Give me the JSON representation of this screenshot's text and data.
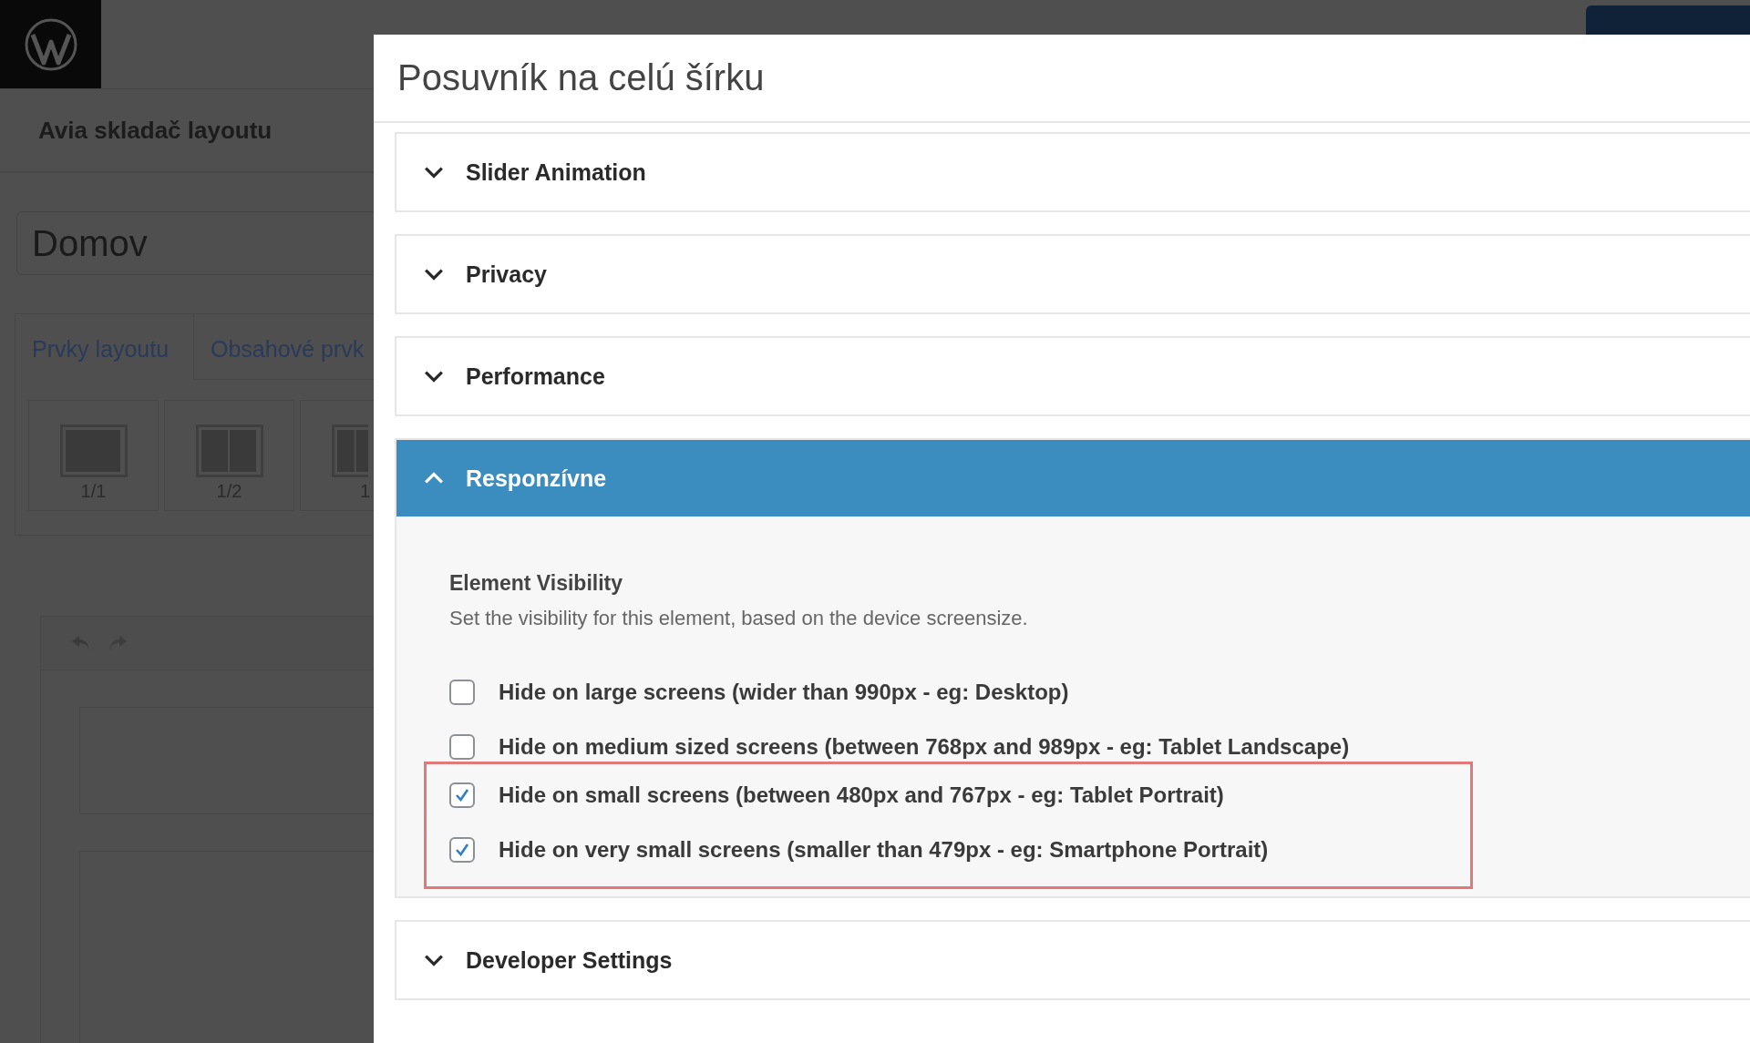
{
  "background": {
    "builder_title": "Avia skladač layoutu",
    "post_title": "Domov",
    "tabs": [
      {
        "label": "Prvky layoutu",
        "selected": true
      },
      {
        "label": "Obsahové prvk",
        "selected": false
      }
    ],
    "layout_tiles": [
      {
        "label": "1/1"
      },
      {
        "label": "1/2"
      },
      {
        "label": "1"
      }
    ]
  },
  "modal": {
    "title": "Posuvník na celú šírku",
    "sections": [
      {
        "label": "Slider Animation",
        "expanded": false
      },
      {
        "label": "Privacy",
        "expanded": false
      },
      {
        "label": "Performance",
        "expanded": false
      },
      {
        "label": "Responzívne",
        "expanded": true,
        "heading": "Element Visibility",
        "description": "Set the visibility for this element, based on the device screensize.",
        "options": [
          {
            "label": "Hide on large screens (wider than 990px - eg: Desktop)",
            "checked": false,
            "highlighted": false
          },
          {
            "label": "Hide on medium sized screens (between 768px and 989px - eg: Tablet Landscape)",
            "checked": false,
            "highlighted": false
          },
          {
            "label": "Hide on small screens (between 480px and 767px - eg: Tablet Portrait)",
            "checked": true,
            "highlighted": true
          },
          {
            "label": "Hide on very small screens (smaller than 479px - eg: Smartphone Portrait)",
            "checked": true,
            "highlighted": true
          }
        ]
      },
      {
        "label": "Developer Settings",
        "expanded": false
      }
    ]
  }
}
